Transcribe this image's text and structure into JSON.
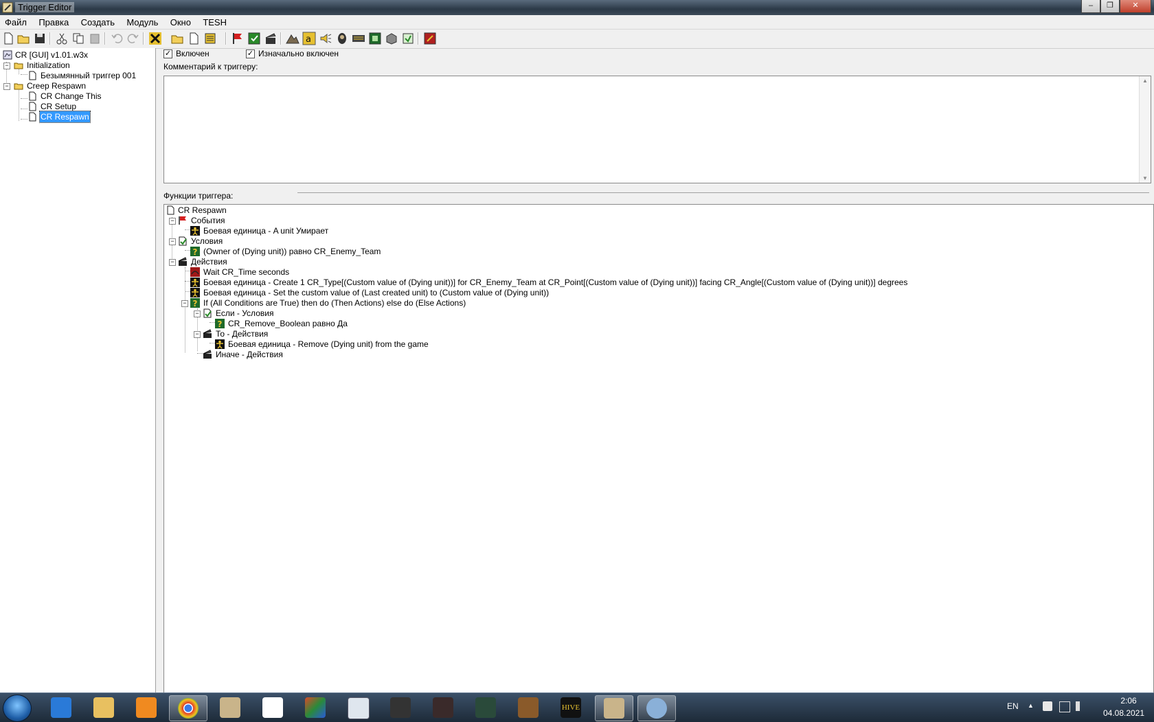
{
  "window": {
    "title": "Trigger Editor",
    "minimize": "‒",
    "maximize": "❐",
    "close": "✕"
  },
  "menu": [
    "Файл",
    "Правка",
    "Создать",
    "Модуль",
    "Окно",
    "TESH"
  ],
  "tree": {
    "root": "CR [GUI] v1.01.w3x",
    "cat1": "Initialization",
    "cat1_item1": "Безымянный триггер 001",
    "cat2": "Creep Respawn",
    "cat2_item1": "CR Change This",
    "cat2_item2": "CR Setup",
    "cat2_item3": "CR Respawn"
  },
  "props": {
    "enabled_label": "Включен",
    "enabled_mark": "✓",
    "initially_on_label": "Изначально включен",
    "initially_on_mark": "✓",
    "comment_label": "Комментарий к триггеру:",
    "functions_label": "Функции триггера:"
  },
  "trigger": {
    "name": "CR Respawn",
    "events_label": "События",
    "event1": "Боевая единица - A unit Умирает",
    "conditions_label": "Условия",
    "cond1": "(Owner of (Dying unit)) равно CR_Enemy_Team",
    "actions_label": "Действия",
    "act1": "Wait CR_Time seconds",
    "act2": "Боевая единица - Create 1 CR_Type[(Custom value of (Dying unit))] for CR_Enemy_Team at CR_Point[(Custom value of (Dying unit))] facing CR_Angle[(Custom value of (Dying unit))] degrees",
    "act3": "Боевая единица - Set the custom value of (Last created unit) to (Custom value of (Dying unit))",
    "act4": "If (All Conditions are True) then do (Then Actions) else do (Else Actions)",
    "if_cond": "Если - Условия",
    "if_cond1": "CR_Remove_Boolean равно Да",
    "then_label": "То - Действия",
    "then1": "Боевая единица - Remove (Dying unit) from the game",
    "else_label": "Иначе - Действия"
  },
  "taskbar": {
    "lang": "EN",
    "time": "2:06",
    "date": "04.08.2021",
    "tray_up": "▲",
    "hive_label": "HIVE"
  },
  "colors": {
    "selection": "#3399ff",
    "taskbar": "#1d2a38",
    "flag_red": "#d42020"
  }
}
